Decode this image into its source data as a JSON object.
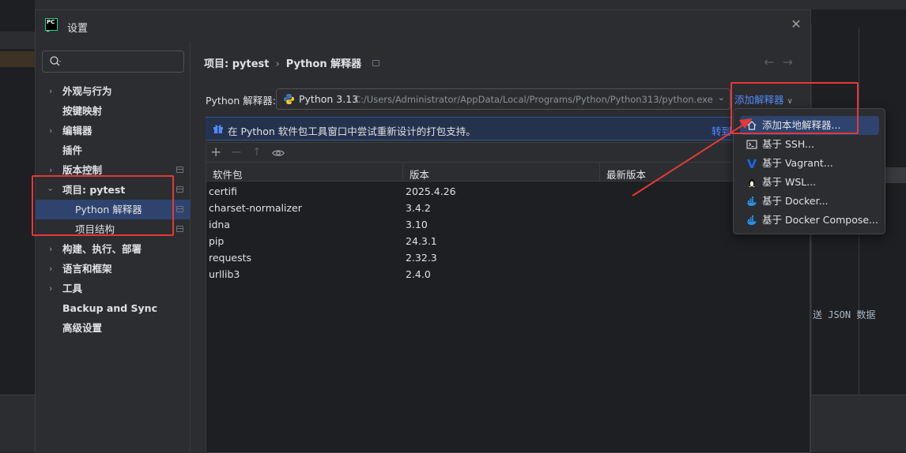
{
  "dialog": {
    "title": "设置",
    "logo_text_line1": "PC",
    "logo_text_line2": "_"
  },
  "sidebar": {
    "search_placeholder": "",
    "items": [
      {
        "label": "外观与行为",
        "expandable": true,
        "pinned": false
      },
      {
        "label": "按键映射",
        "expandable": false,
        "pinned": false
      },
      {
        "label": "编辑器",
        "expandable": true,
        "pinned": false
      },
      {
        "label": "插件",
        "expandable": false,
        "pinned": false
      },
      {
        "label": "版本控制",
        "expandable": true,
        "pinned": true
      },
      {
        "label": "项目: pytest",
        "expandable": true,
        "expanded": true,
        "pinned": true
      },
      {
        "label": "Python 解释器",
        "sub": true,
        "selected": true,
        "pinned": true
      },
      {
        "label": "项目结构",
        "sub": true,
        "pinned": true
      },
      {
        "label": "构建、执行、部署",
        "expandable": true,
        "pinned": false
      },
      {
        "label": "语言和框架",
        "expandable": true,
        "pinned": false
      },
      {
        "label": "工具",
        "expandable": true,
        "pinned": false
      },
      {
        "label": "Backup and Sync",
        "expandable": false,
        "pinned": false
      },
      {
        "label": "高级设置",
        "expandable": false,
        "pinned": false
      }
    ]
  },
  "main": {
    "breadcrumb": {
      "project": "项目: pytest",
      "separator": "›",
      "page": "Python 解释器"
    },
    "nav": {
      "back": "←",
      "forward": "→"
    },
    "interpreter": {
      "label": "Python 解释器:",
      "name": "Python 3.13",
      "path": "C:/Users/Administrator/AppData/Local/Programs/Python/Python313/python.exe",
      "add_label": "添加解释器"
    },
    "banner": {
      "text": "在 Python 软件包工具窗口中尝试重新设计的打包支持。",
      "link": "转到"
    },
    "table": {
      "headers": [
        "软件包",
        "版本",
        "最新版本"
      ],
      "rows": [
        {
          "package": "certifi",
          "version": "2025.4.26"
        },
        {
          "package": "charset-normalizer",
          "version": "3.4.2"
        },
        {
          "package": "idna",
          "version": "3.10"
        },
        {
          "package": "pip",
          "version": "24.3.1"
        },
        {
          "package": "requests",
          "version": "2.32.3"
        },
        {
          "package": "urllib3",
          "version": "2.4.0"
        }
      ]
    }
  },
  "dropdown": {
    "items": [
      {
        "label": "添加本地解释器...",
        "icon": "home-icon",
        "highlighted": true
      },
      {
        "label": "基于 SSH...",
        "icon": "terminal-icon"
      },
      {
        "label": "基于 Vagrant...",
        "icon": "vagrant-icon"
      },
      {
        "label": "基于 WSL...",
        "icon": "linux-icon"
      },
      {
        "label": "基于 Docker...",
        "icon": "docker-icon"
      },
      {
        "label": "基于 Docker Compose...",
        "icon": "docker-compose-icon"
      }
    ]
  },
  "background": {
    "code_text": "送 JSON 数据"
  },
  "colors": {
    "accent": "#548af7",
    "selection": "#2e436e",
    "annotation": "#e53935"
  }
}
